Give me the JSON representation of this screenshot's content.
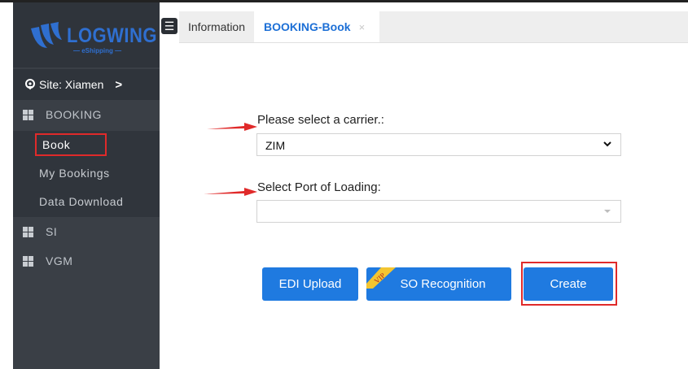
{
  "sidebar": {
    "logo_text": "LOGWING",
    "logo_sub": "— eShipping —",
    "site_label": "Site: Xiamen",
    "site_chevron": ">",
    "menu": [
      {
        "label": "BOOKING"
      },
      {
        "label": "SI"
      },
      {
        "label": "VGM"
      }
    ],
    "booking_sub": [
      {
        "label": "Book"
      },
      {
        "label": "My Bookings"
      },
      {
        "label": "Data Download"
      }
    ]
  },
  "tabs": {
    "info": "Information",
    "active": "BOOKING-Book",
    "close": "×"
  },
  "form": {
    "carrier_label": "Please select a carrier.:",
    "carrier_value": "ZIM",
    "pol_label": "Select Port of Loading:",
    "pol_value": ""
  },
  "buttons": {
    "edi_upload": "EDI Upload",
    "so_recognition": "SO Recognition",
    "create": "Create",
    "vip_badge": "VIP"
  },
  "colors": {
    "accent": "#1f7ae0",
    "highlight": "#e02a2a",
    "sidebar_bg": "#3a3f46"
  }
}
